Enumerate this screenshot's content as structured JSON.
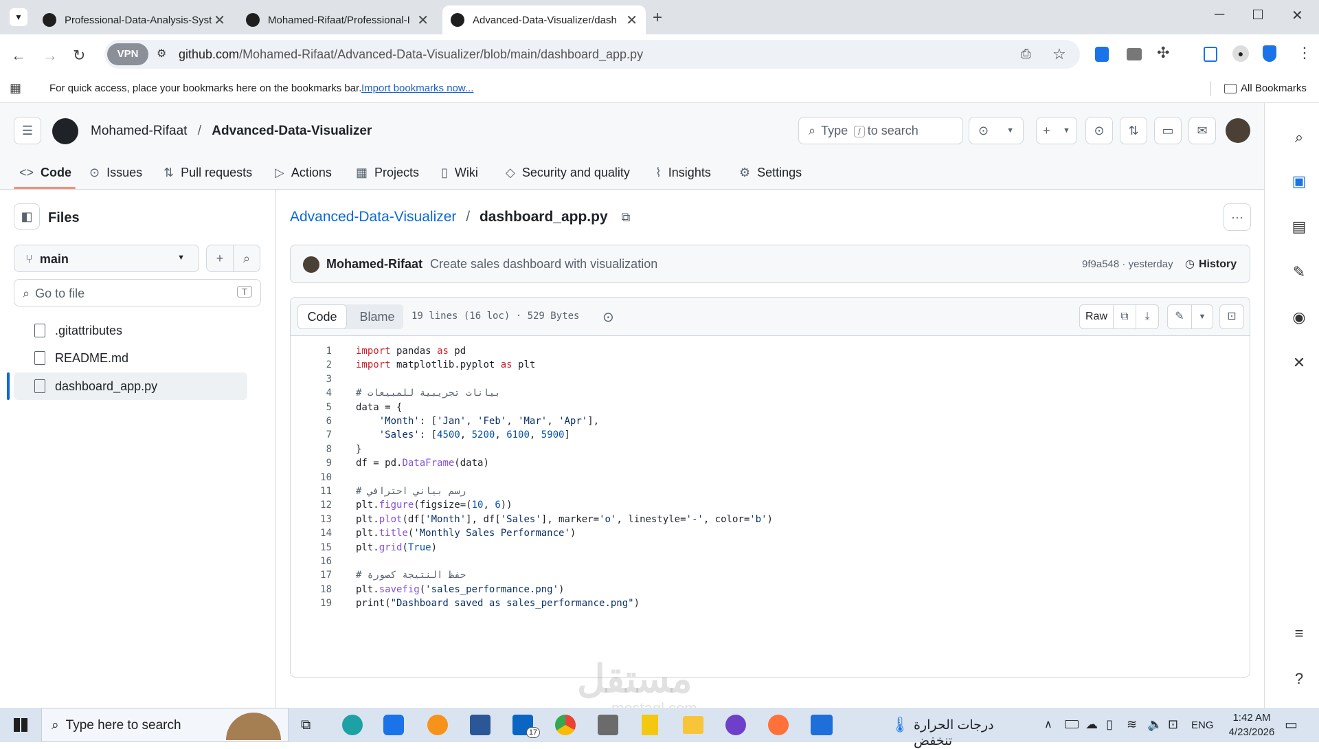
{
  "browser": {
    "tabs": [
      {
        "title": "Professional-Data-Analysis-Syst",
        "active": false
      },
      {
        "title": "Mohamed-Rifaat/Professional-I",
        "active": false
      },
      {
        "title": "Advanced-Data-Visualizer/dash",
        "active": true
      }
    ],
    "vpn_label": "VPN",
    "url_host": "github.com",
    "url_path": "/Mohamed-Rifaat/Advanced-Data-Visualizer/blob/main/dashboard_app.py",
    "bookmarks_prompt": "For quick access, place your bookmarks here on the bookmarks bar.",
    "import_bookmarks": "Import bookmarks now...",
    "all_bookmarks": "All Bookmarks"
  },
  "repo": {
    "owner": "Mohamed-Rifaat",
    "separator": "/",
    "name": "Advanced-Data-Visualizer",
    "search_placeholder_pre": "Type",
    "search_key": "/",
    "search_placeholder_post": "to search"
  },
  "nav_tabs": [
    {
      "label": "Code",
      "icon": "code-icon",
      "active": true
    },
    {
      "label": "Issues",
      "icon": "issue-icon"
    },
    {
      "label": "Pull requests",
      "icon": "pull-request-icon"
    },
    {
      "label": "Actions",
      "icon": "play-icon"
    },
    {
      "label": "Projects",
      "icon": "table-icon"
    },
    {
      "label": "Wiki",
      "icon": "book-icon"
    },
    {
      "label": "Security and quality",
      "icon": "shield-icon"
    },
    {
      "label": "Insights",
      "icon": "graph-icon"
    },
    {
      "label": "Settings",
      "icon": "gear-icon"
    }
  ],
  "sidebar": {
    "title": "Files",
    "branch": "main",
    "goto_placeholder": "Go to file",
    "goto_key": "T",
    "files": [
      {
        "name": ".gitattributes",
        "selected": false
      },
      {
        "name": "README.md",
        "selected": false
      },
      {
        "name": "dashboard_app.py",
        "selected": true
      }
    ]
  },
  "file": {
    "repo_link": "Advanced-Data-Visualizer",
    "separator": "/",
    "filename": "dashboard_app.py",
    "commit_author": "Mohamed-Rifaat",
    "commit_message": "Create sales dashboard with visualization",
    "commit_hash": "9f9a548",
    "commit_time": "· yesterday",
    "history_label": "History",
    "tab_code": "Code",
    "tab_blame": "Blame",
    "stats": "19 lines (16 loc) · 529 Bytes",
    "raw_label": "Raw"
  },
  "code_lines": [
    "import pandas as pd",
    "import matplotlib.pyplot as plt",
    "",
    "# بيانات تجريبية للمبيعات",
    "data = {",
    "    'Month': ['Jan', 'Feb', 'Mar', 'Apr'],",
    "    'Sales': [4500, 5200, 6100, 5900]",
    "}",
    "df = pd.DataFrame(data)",
    "",
    "# رسم بياني احترافي",
    "plt.figure(figsize=(10, 6))",
    "plt.plot(df['Month'], df['Sales'], marker='o', linestyle='-', color='b')",
    "plt.title('Monthly Sales Performance')",
    "plt.grid(True)",
    "",
    "# حفظ النتيجة كصورة",
    "plt.savefig('sales_performance.png')",
    "print(\"Dashboard saved as sales_performance.png\")"
  ],
  "taskbar": {
    "search_placeholder": "Type here to search",
    "weather_text": "درجات الحرارة تنخفض",
    "language": "ENG",
    "time": "1:42 AM",
    "date": "4/23/2026",
    "linkedin_badge": "17"
  },
  "watermark": "mostaql.com",
  "colors": {
    "accent": "#0969da",
    "keyword": "#cf222e",
    "string": "#0a3069",
    "function": "#8250df",
    "number": "#0550ae",
    "comment": "#59636e",
    "active_underline": "#fd8c73"
  }
}
